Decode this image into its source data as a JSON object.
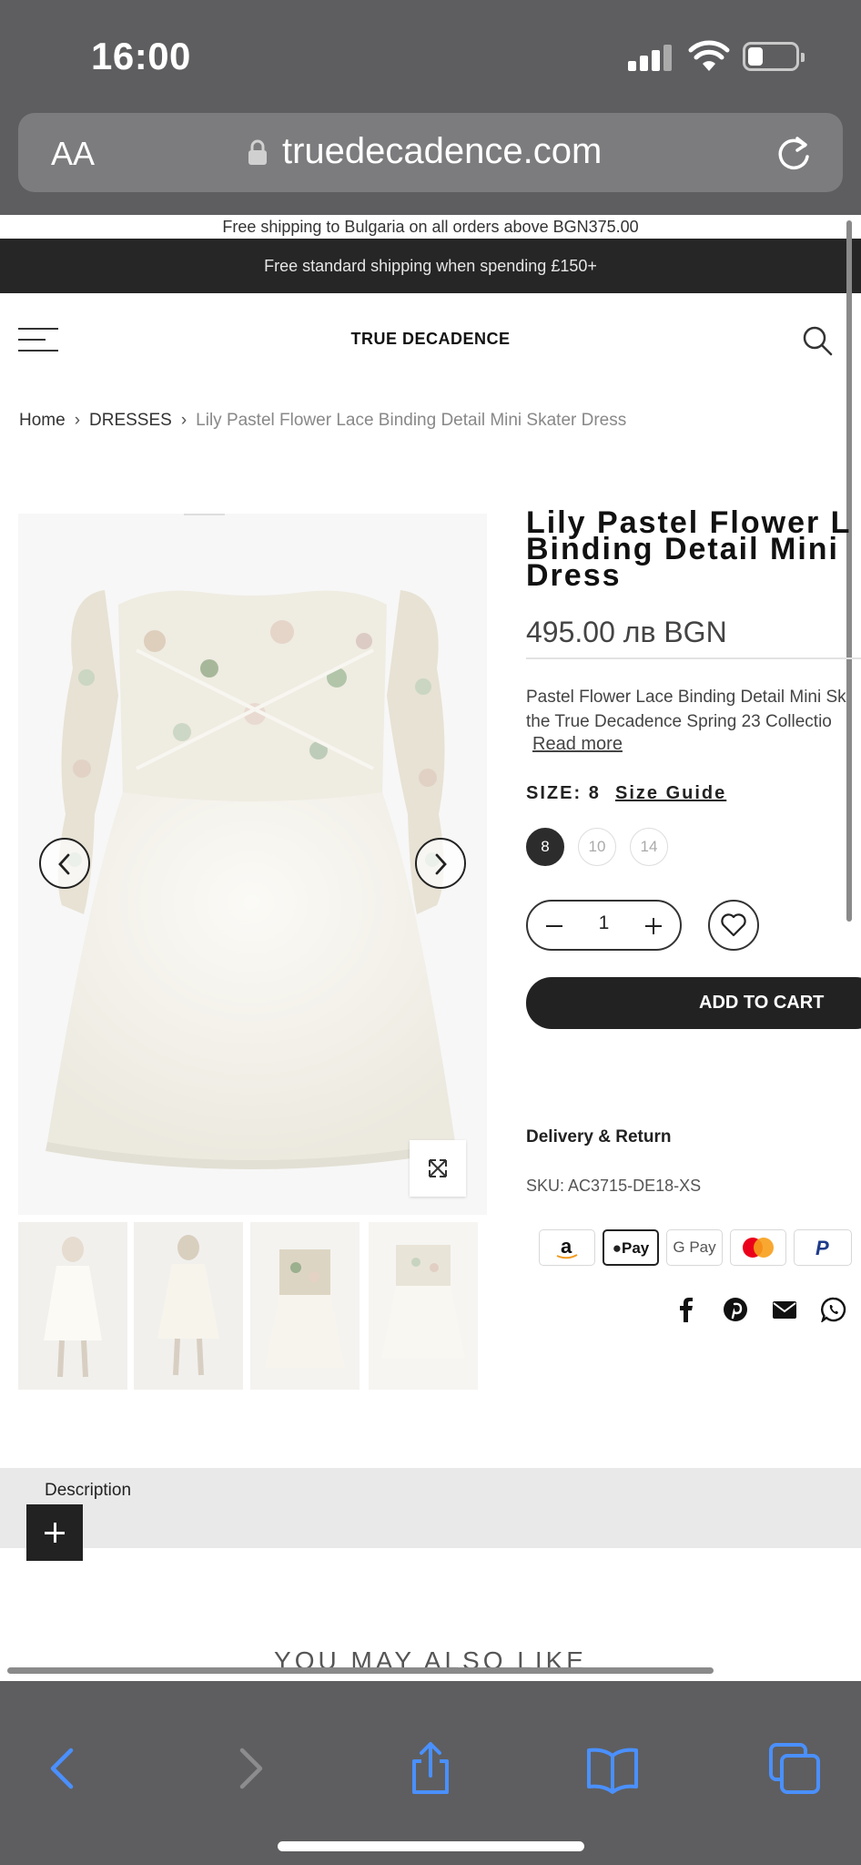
{
  "status_bar": {
    "time": "16:00"
  },
  "safari": {
    "text_size_label": "AA",
    "url": "truedecadence.com"
  },
  "site": {
    "shipping_notice": "Free shipping to Bulgaria on all orders above BGN375.00",
    "promo_banner": "Free standard shipping when spending £150+",
    "brand": "TRUE DECADENCE"
  },
  "breadcrumb": {
    "home": "Home",
    "category": "DRESSES",
    "current": "Lily Pastel Flower Lace Binding Detail Mini Skater Dress"
  },
  "product": {
    "title_lines": [
      "Lily Pastel Flower L",
      "Binding Detail Mini",
      "Dress"
    ],
    "price": "495.00 лв BGN",
    "description_lines": [
      "Pastel Flower Lace Binding Detail Mini Sk",
      "the True Decadence Spring 23 Collectio"
    ],
    "read_more": "Read more",
    "size_label": "SIZE:",
    "size_value": "8",
    "size_guide": "Size Guide",
    "sizes": [
      "8",
      "10",
      "14"
    ],
    "selected_size": "8",
    "quantity": "1",
    "add_to_cart": "ADD TO CART",
    "delivery_return": "Delivery & Return",
    "sku_label": "SKU:",
    "sku_value": "AC3715-DE18-XS"
  },
  "payment_methods": [
    "amazon-pay",
    "apple-pay",
    "google-pay",
    "mastercard",
    "paypal"
  ],
  "payment_labels": {
    "apple_pay": "Pay",
    "google_pay": "G Pay"
  },
  "social": [
    "facebook",
    "pinterest",
    "email",
    "whatsapp"
  ],
  "sections": {
    "description": "Description",
    "also_like": "YOU MAY ALSO LIKE"
  },
  "colors": {
    "dark": "#222222",
    "safari_chrome": "#5e5e60",
    "ios_blue": "#3b82f6",
    "promo_bg": "#262626"
  }
}
